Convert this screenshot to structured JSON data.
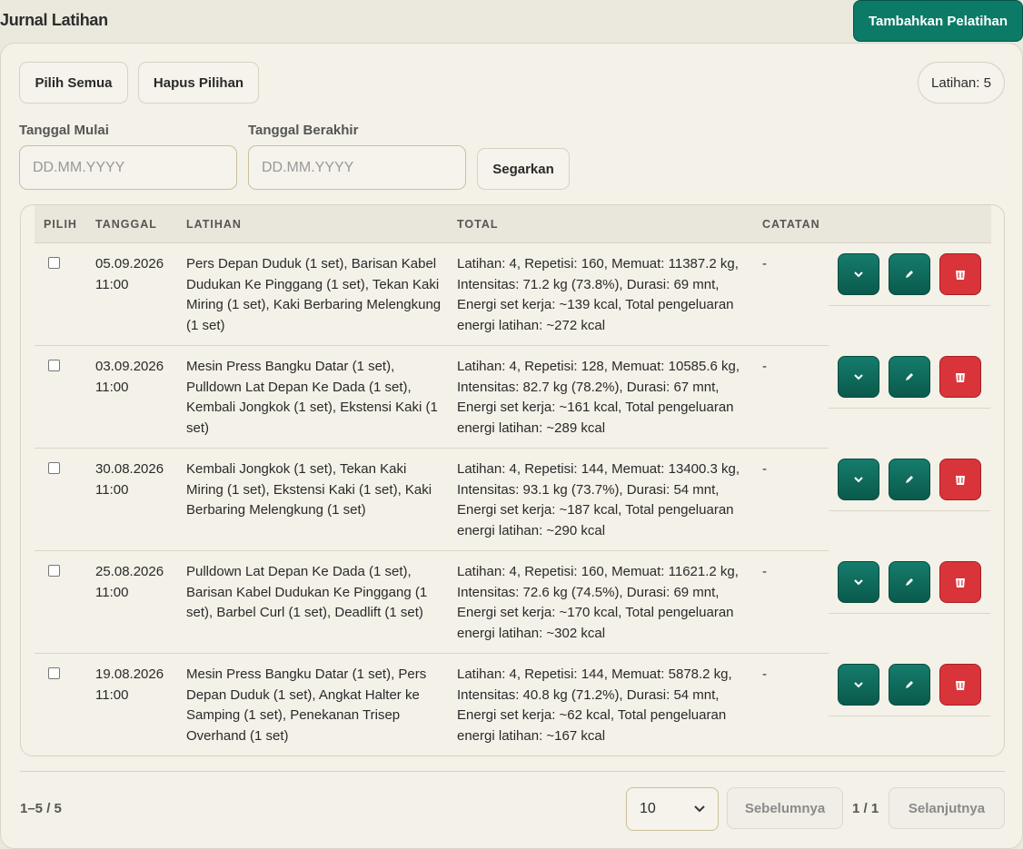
{
  "header": {
    "title": "Jurnal Latihan",
    "add_button": "Tambahkan Pelatihan"
  },
  "toolbar": {
    "select_all": "Pilih Semua",
    "clear_selection": "Hapus Pilihan",
    "count": "Latihan: 5"
  },
  "filters": {
    "start_label": "Tanggal Mulai",
    "end_label": "Tanggal Berakhir",
    "start_placeholder": "DD.MM.YYYY",
    "end_placeholder": "DD.MM.YYYY",
    "refresh": "Segarkan"
  },
  "table": {
    "columns": {
      "select": "PILIH",
      "date": "TANGGAL",
      "exercises": "LATIHAN",
      "total": "TOTAL",
      "notes": "CATATAN"
    },
    "rows": [
      {
        "date": "05.09.2026",
        "time": "11:00",
        "exercises": "Pers Depan Duduk (1 set), Barisan Kabel Dudukan Ke Pinggang (1 set), Tekan Kaki Miring (1 set), Kaki Berbaring Melengkung (1 set)",
        "total": "Latihan: 4, Repetisi: 160, Memuat: 11387.2 kg, Intensitas: 71.2 kg (73.8%), Durasi: 69 mnt, Energi set kerja: ~139 kcal, Total pengeluaran energi latihan: ~272 kcal",
        "notes": "-"
      },
      {
        "date": "03.09.2026",
        "time": "11:00",
        "exercises": "Mesin Press Bangku Datar (1 set), Pulldown Lat Depan Ke Dada (1 set), Kembali Jongkok (1 set), Ekstensi Kaki (1 set)",
        "total": "Latihan: 4, Repetisi: 128, Memuat: 10585.6 kg, Intensitas: 82.7 kg (78.2%), Durasi: 67 mnt, Energi set kerja: ~161 kcal, Total pengeluaran energi latihan: ~289 kcal",
        "notes": "-"
      },
      {
        "date": "30.08.2026",
        "time": "11:00",
        "exercises": "Kembali Jongkok (1 set), Tekan Kaki Miring (1 set), Ekstensi Kaki (1 set), Kaki Berbaring Melengkung (1 set)",
        "total": "Latihan: 4, Repetisi: 144, Memuat: 13400.3 kg, Intensitas: 93.1 kg (73.7%), Durasi: 54 mnt, Energi set kerja: ~187 kcal, Total pengeluaran energi latihan: ~290 kcal",
        "notes": "-"
      },
      {
        "date": "25.08.2026",
        "time": "11:00",
        "exercises": "Pulldown Lat Depan Ke Dada (1 set), Barisan Kabel Dudukan Ke Pinggang (1 set), Barbel Curl (1 set), Deadlift (1 set)",
        "total": "Latihan: 4, Repetisi: 160, Memuat: 11621.2 kg, Intensitas: 72.6 kg (74.5%), Durasi: 69 mnt, Energi set kerja: ~170 kcal, Total pengeluaran energi latihan: ~302 kcal",
        "notes": "-"
      },
      {
        "date": "19.08.2026",
        "time": "11:00",
        "exercises": "Mesin Press Bangku Datar (1 set), Pers Depan Duduk (1 set), Angkat Halter ke Samping (1 set), Penekanan Trisep Overhand (1 set)",
        "total": "Latihan: 4, Repetisi: 144, Memuat: 5878.2 kg, Intensitas: 40.8 kg (71.2%), Durasi: 54 mnt, Energi set kerja: ~62 kcal, Total pengeluaran energi latihan: ~167 kcal",
        "notes": "-"
      }
    ],
    "icons": {
      "expand": "chevron-down-icon",
      "edit": "pencil-icon",
      "delete": "trash-icon"
    }
  },
  "pagination": {
    "range": "1–5 / 5",
    "page_size": "10",
    "prev": "Sebelumnya",
    "page": "1 / 1",
    "next": "Selanjutnya"
  },
  "colors": {
    "accent": "#0b7a66",
    "danger": "#d9343a",
    "background": "#ebe8dd"
  }
}
